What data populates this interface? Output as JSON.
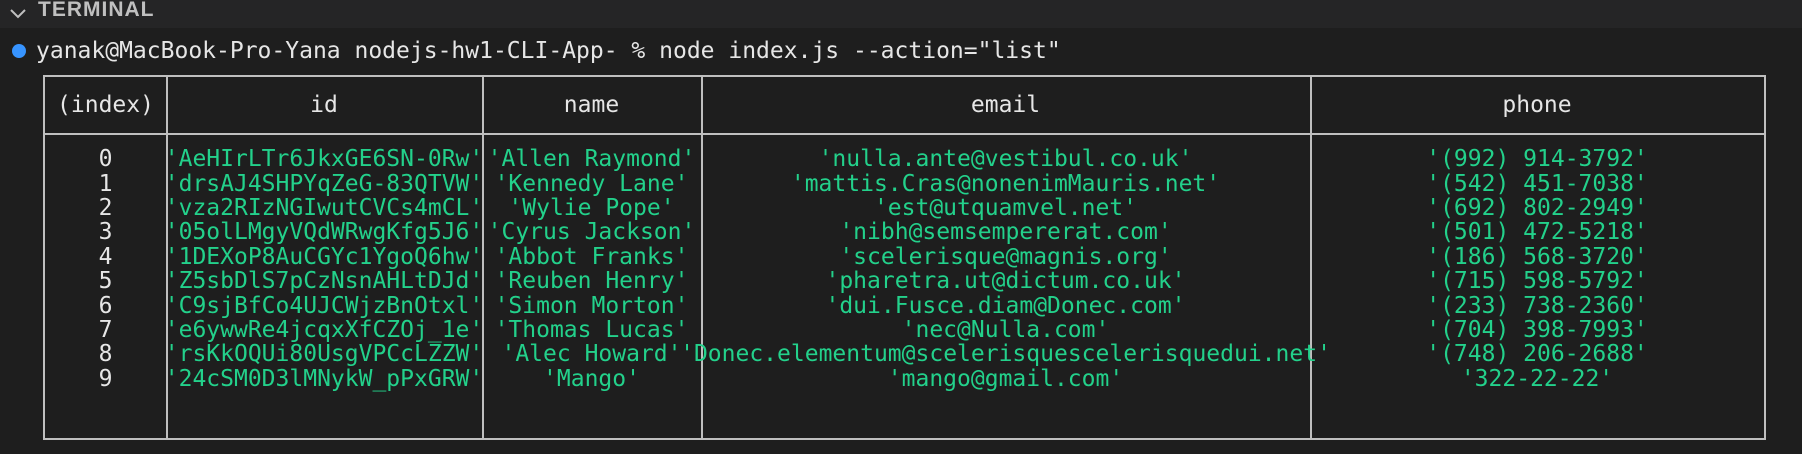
{
  "panel": {
    "title": "TERMINAL"
  },
  "prompt": {
    "text": "yanak@MacBook-Pro-Yana nodejs-hw1-CLI-App- % node index.js --action=\"list\""
  },
  "table": {
    "headers": [
      "(index)",
      "id",
      "name",
      "email",
      "phone"
    ],
    "rows": [
      {
        "index": "0",
        "id": "'AeHIrLTr6JkxGE6SN-0Rw'",
        "name": "'Allen Raymond'",
        "email": "'nulla.ante@vestibul.co.uk'",
        "phone": "'(992) 914-3792'"
      },
      {
        "index": "1",
        "id": "'drsAJ4SHPYqZeG-83QTVW'",
        "name": "'Kennedy Lane'",
        "email": "'mattis.Cras@nonenimMauris.net'",
        "phone": "'(542) 451-7038'"
      },
      {
        "index": "2",
        "id": "'vza2RIzNGIwutCVCs4mCL'",
        "name": "'Wylie Pope'",
        "email": "'est@utquamvel.net'",
        "phone": "'(692) 802-2949'"
      },
      {
        "index": "3",
        "id": "'05olLMgyVQdWRwgKfg5J6'",
        "name": "'Cyrus Jackson'",
        "email": "'nibh@semsempererat.com'",
        "phone": "'(501) 472-5218'"
      },
      {
        "index": "4",
        "id": "'1DEXoP8AuCGYc1YgoQ6hw'",
        "name": "'Abbot Franks'",
        "email": "'scelerisque@magnis.org'",
        "phone": "'(186) 568-3720'"
      },
      {
        "index": "5",
        "id": "'Z5sbDlS7pCzNsnAHLtDJd'",
        "name": "'Reuben Henry'",
        "email": "'pharetra.ut@dictum.co.uk'",
        "phone": "'(715) 598-5792'"
      },
      {
        "index": "6",
        "id": "'C9sjBfCo4UJCWjzBnOtxl'",
        "name": "'Simon Morton'",
        "email": "'dui.Fusce.diam@Donec.com'",
        "phone": "'(233) 738-2360'"
      },
      {
        "index": "7",
        "id": "'e6ywwRe4jcqxXfCZOj_1e'",
        "name": "'Thomas Lucas'",
        "email": "'nec@Nulla.com'",
        "phone": "'(704) 398-7993'"
      },
      {
        "index": "8",
        "id": "'rsKkOQUi80UsgVPCcLZZW'",
        "name": "'Alec Howard'",
        "email": "'Donec.elementum@scelerisquescelerisquedui.net'",
        "phone": "'(748) 206-2688'"
      },
      {
        "index": "9",
        "id": "'24cSM0D3lMNykW_pPxGRW'",
        "name": "'Mango'",
        "email": "'mango@gmail.com'",
        "phone": "'322-22-22'"
      }
    ]
  },
  "colors": {
    "background": "#1e1e1e",
    "string": "#23d18b",
    "border": "#bfbfbf",
    "dot": "#3794ff"
  }
}
